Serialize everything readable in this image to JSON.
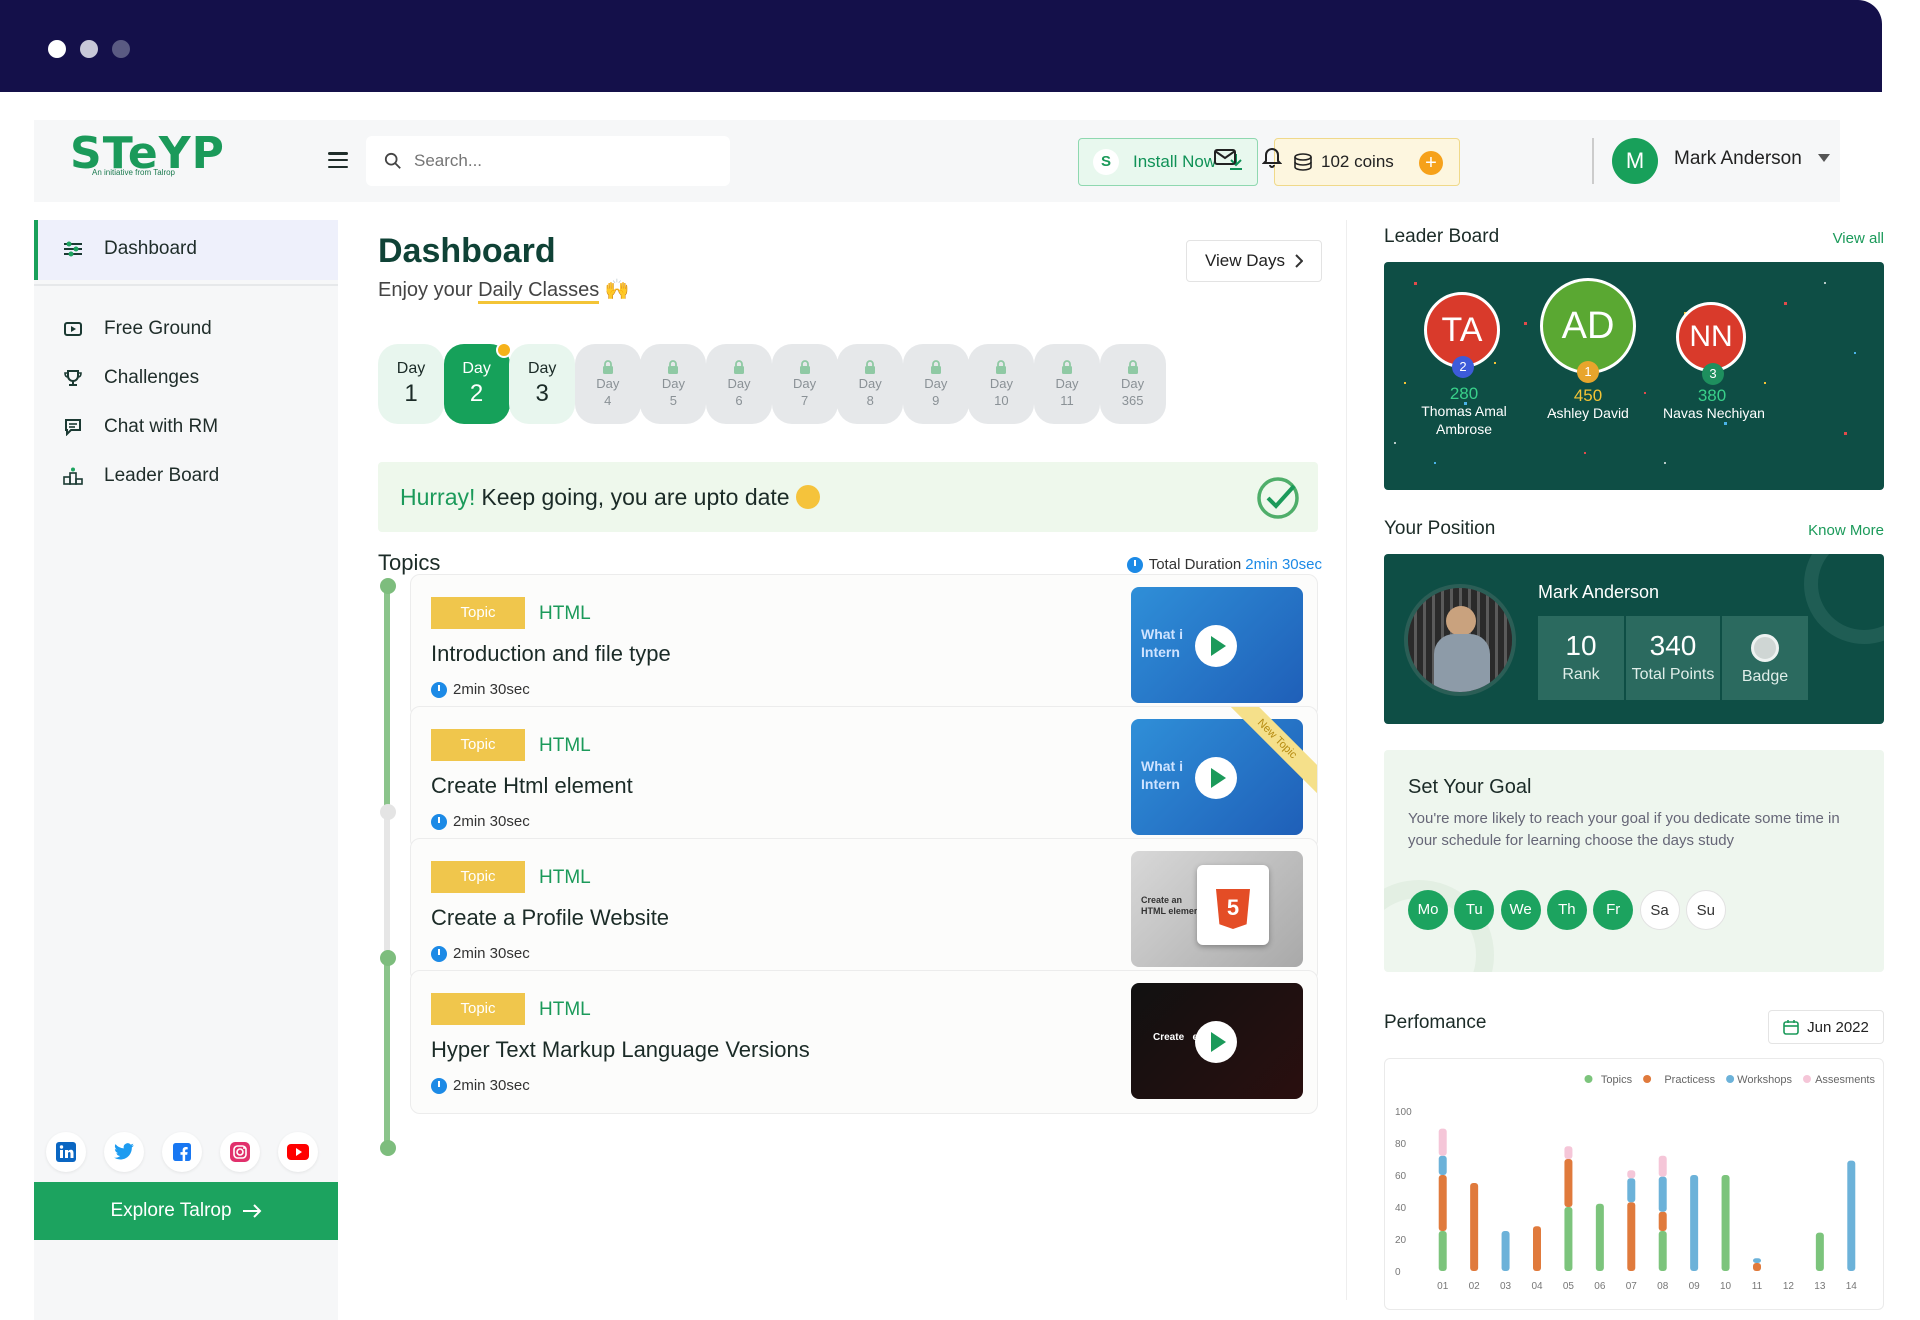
{
  "browser": {
    "dots": [
      "#ffffff",
      "#c8c8d8",
      "#5a5a82"
    ]
  },
  "brand": {
    "logo": "STeYP",
    "tagline": "An initiative from Talrop"
  },
  "header": {
    "search_placeholder": "Search...",
    "install_label": "Install Now",
    "coins_label": "102 coins",
    "user_initial": "M",
    "user_name": "Mark Anderson"
  },
  "sidebar": {
    "items": [
      {
        "label": "Dashboard",
        "icon": "sliders-icon"
      },
      {
        "label": "Free Ground",
        "icon": "play-screen-icon"
      },
      {
        "label": "Challenges",
        "icon": "trophy-icon"
      },
      {
        "label": "Chat with RM",
        "icon": "chat-icon"
      },
      {
        "label": "Leader Board",
        "icon": "podium-icon"
      }
    ],
    "socials": [
      "linkedin-icon",
      "twitter-icon",
      "facebook-icon",
      "instagram-icon",
      "youtube-icon"
    ],
    "explore_label": "Explore Talrop"
  },
  "dashboard": {
    "title": "Dashboard",
    "subtitle_prefix": "Enjoy your ",
    "subtitle_highlight": "Daily Classes",
    "view_days": "View Days",
    "days": [
      {
        "label": "Day",
        "num": "1",
        "state": "open"
      },
      {
        "label": "Day",
        "num": "2",
        "state": "active"
      },
      {
        "label": "Day",
        "num": "3",
        "state": "open"
      },
      {
        "label": "Day",
        "num": "4",
        "state": "locked"
      },
      {
        "label": "Day",
        "num": "5",
        "state": "locked"
      },
      {
        "label": "Day",
        "num": "6",
        "state": "locked"
      },
      {
        "label": "Day",
        "num": "7",
        "state": "locked"
      },
      {
        "label": "Day",
        "num": "8",
        "state": "locked"
      },
      {
        "label": "Day",
        "num": "9",
        "state": "locked"
      },
      {
        "label": "Day",
        "num": "10",
        "state": "locked"
      },
      {
        "label": "Day",
        "num": "11",
        "state": "locked"
      },
      {
        "label": "Day",
        "num": "365",
        "state": "locked"
      }
    ],
    "hurray_word": "Hurray!",
    "hurray_text": "Keep going, you are upto date",
    "topics_title": "Topics",
    "total_duration_label": "Total Duration",
    "total_duration_value": "2min 30sec",
    "topics": [
      {
        "tag": "Topic",
        "lang": "HTML",
        "title": "Introduction and file type",
        "duration": "2min 30sec",
        "thumb_text": "What i\nIntern",
        "new": false
      },
      {
        "tag": "Topic",
        "lang": "HTML",
        "title": "Create Html element",
        "duration": "2min 30sec",
        "thumb_text": "What i\nIntern",
        "new": true,
        "new_label": "New Topic"
      },
      {
        "tag": "Topic",
        "lang": "HTML",
        "title": "Create a Profile Website",
        "duration": "2min 30sec",
        "thumb_text": "Create an\nHTML element",
        "new": false
      },
      {
        "tag": "Topic",
        "lang": "HTML",
        "title": "Hyper Text Markup Language Versions",
        "duration": "2min 30sec",
        "thumb_text": "Create   ebsite",
        "new": false
      }
    ]
  },
  "leaderboard": {
    "title": "Leader Board",
    "link": "View all",
    "leaders": [
      {
        "initials": "TA",
        "rank": "2",
        "points": "280",
        "name": "Thomas Amal Ambrose",
        "color": "#d93a2b"
      },
      {
        "initials": "AD",
        "rank": "1",
        "points": "450",
        "name": "Ashley David",
        "color": "#5aa832"
      },
      {
        "initials": "NN",
        "rank": "3",
        "points": "380",
        "name": "Navas Nechiyan",
        "color": "#d93a2b"
      }
    ]
  },
  "position": {
    "title": "Your Position",
    "link": "Know More",
    "name": "Mark Anderson",
    "rank_value": "10",
    "rank_label": "Rank",
    "points_value": "340",
    "points_label": "Total Points",
    "badge_label": "Badge"
  },
  "goal": {
    "title": "Set Your Goal",
    "text": "You're more likely to reach your goal if you dedicate some time in your schedule for learning choose the days study",
    "days": [
      {
        "label": "Mo",
        "on": true
      },
      {
        "label": "Tu",
        "on": true
      },
      {
        "label": "We",
        "on": true
      },
      {
        "label": "Th",
        "on": true
      },
      {
        "label": "Fr",
        "on": true
      },
      {
        "label": "Sa",
        "on": false
      },
      {
        "label": "Su",
        "on": false
      }
    ]
  },
  "performance": {
    "title": "Perfomance",
    "month": "Jun 2022"
  },
  "chart_data": {
    "type": "bar",
    "stacked": true,
    "categories": [
      "01",
      "02",
      "03",
      "04",
      "05",
      "06",
      "07",
      "08",
      "09",
      "10",
      "11",
      "12",
      "13",
      "14"
    ],
    "ylim": [
      0,
      100
    ],
    "yticks": [
      0,
      20,
      40,
      60,
      80,
      100
    ],
    "legend_position": "top-right",
    "series": [
      {
        "name": "Topics",
        "color": "#7cc47c",
        "values": [
          25,
          0,
          0,
          0,
          40,
          42,
          0,
          25,
          0,
          60,
          0,
          0,
          24,
          0
        ]
      },
      {
        "name": "Practicess",
        "color": "#e07a3c",
        "values": [
          35,
          55,
          0,
          28,
          30,
          0,
          43,
          12,
          0,
          0,
          5,
          0,
          0,
          0
        ]
      },
      {
        "name": "Workshops",
        "color": "#6cb2d9",
        "values": [
          12,
          0,
          25,
          0,
          0,
          0,
          15,
          22,
          60,
          0,
          3,
          0,
          0,
          69
        ]
      },
      {
        "name": "Assesments",
        "color": "#f5c6d8",
        "values": [
          17,
          0,
          0,
          0,
          8,
          0,
          5,
          13,
          0,
          0,
          0,
          0,
          0,
          0
        ]
      }
    ]
  }
}
